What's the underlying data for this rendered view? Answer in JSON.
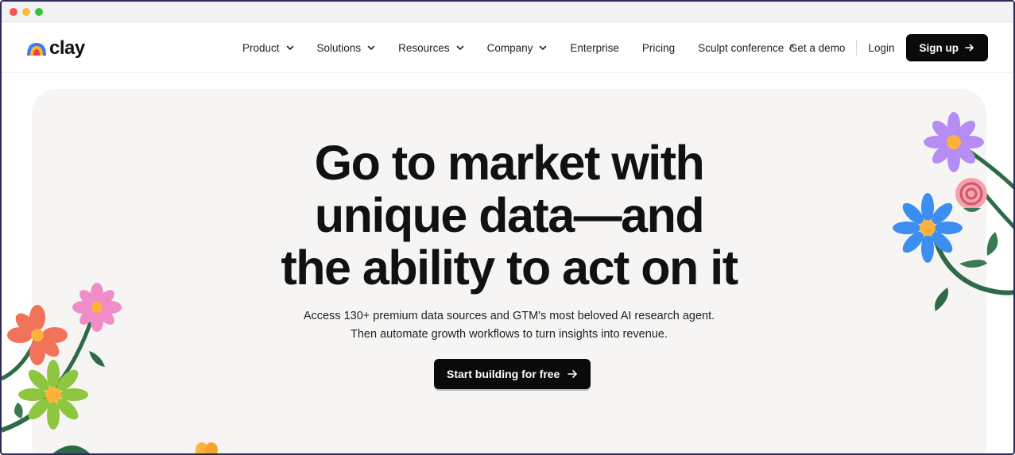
{
  "window": {
    "controls": [
      "close",
      "minimize",
      "maximize"
    ]
  },
  "brand": {
    "name": "clay"
  },
  "nav": {
    "items": [
      {
        "label": "Product",
        "dropdown": true
      },
      {
        "label": "Solutions",
        "dropdown": true
      },
      {
        "label": "Resources",
        "dropdown": true
      },
      {
        "label": "Company",
        "dropdown": true
      },
      {
        "label": "Enterprise",
        "dropdown": false
      },
      {
        "label": "Pricing",
        "dropdown": false
      },
      {
        "label": "Sculpt conference",
        "external": true
      }
    ],
    "demo_label": "Get a demo",
    "login_label": "Login",
    "signup_label": "Sign up"
  },
  "hero": {
    "headline": [
      "Go to market with",
      "unique data—and",
      "the ability to act on it"
    ],
    "subtitle": [
      "Access 130+ premium data sources and GTM's most beloved AI research agent.",
      "Then automate growth workflows to turn insights into revenue."
    ],
    "cta_label": "Start building for free"
  },
  "colors": {
    "primary": "#0a0a0a",
    "hero_bg": "#f6f5f3",
    "frame": "#2d2a5c"
  }
}
